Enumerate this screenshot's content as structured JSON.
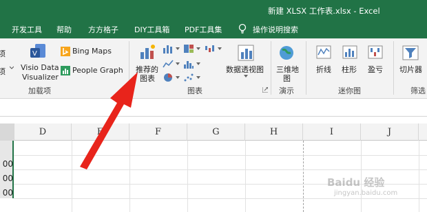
{
  "window": {
    "title": "新建 XLSX 工作表.xlsx  -  Excel"
  },
  "tabs": [
    {
      "label": "开发工具"
    },
    {
      "label": "帮助"
    },
    {
      "label": "方方格子"
    },
    {
      "label": "DIY工具箱"
    },
    {
      "label": "PDF工具集"
    },
    {
      "label": "操作说明搜索"
    }
  ],
  "ribbon": {
    "addins": {
      "partial_label_top": "项",
      "partial_label_mid": "项",
      "visio_label_line1": "Visio Data",
      "visio_label_line2": "Visualizer",
      "bing_maps": "Bing Maps",
      "people_graph": "People Graph",
      "group_label": "加载项"
    },
    "charts": {
      "recommended_line1": "推荐的",
      "recommended_line2": "图表",
      "pivot_chart": "数据透视图",
      "group_label": "图表"
    },
    "tours": {
      "map3d_line1": "三维地",
      "map3d_line2": "图",
      "group_label": "演示"
    },
    "sparklines": {
      "line": "折线",
      "column": "柱形",
      "winloss": "盈亏",
      "group_label": "迷你图"
    },
    "filters": {
      "slicer": "切片器",
      "group_label": "筛选"
    }
  },
  "grid": {
    "columns": [
      "D",
      "E",
      "F",
      "G",
      "H",
      "I",
      "J"
    ],
    "partial_values": [
      "00",
      "00",
      "00"
    ]
  },
  "watermark": {
    "line1": "Baidu 经验",
    "line2": "jingyan.baidu.com"
  },
  "colors": {
    "accent": "#217346",
    "arrow": "#e8241b"
  }
}
